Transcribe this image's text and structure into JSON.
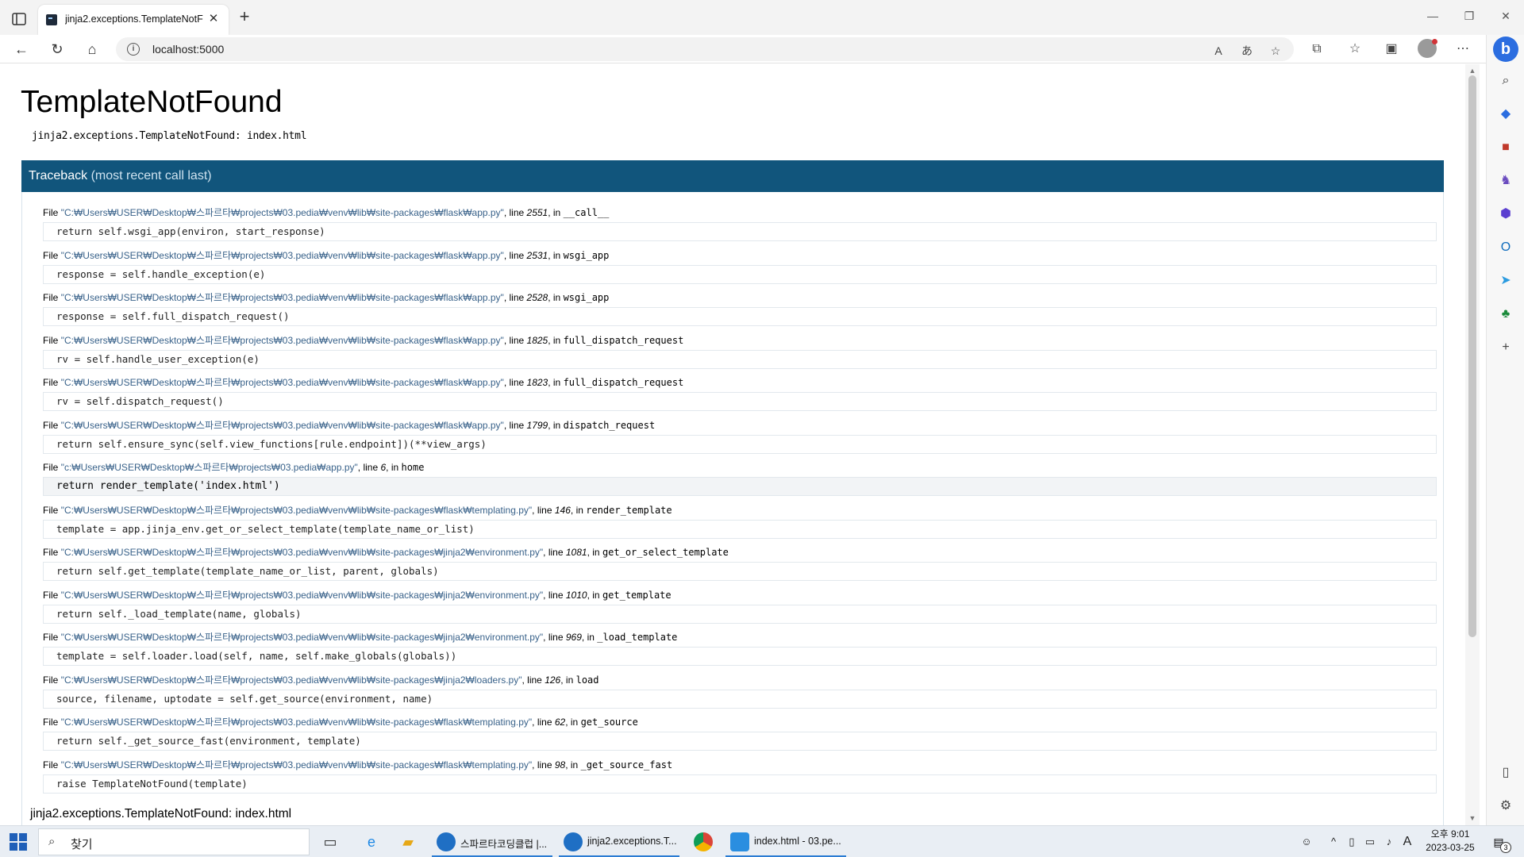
{
  "browser": {
    "tab_title": "jinja2.exceptions.TemplateNotF",
    "tab_close": "✕",
    "new_tab": "+",
    "url": "localhost:5000",
    "window_controls": [
      "—",
      "❐",
      "✕"
    ]
  },
  "error": {
    "title": "TemplateNotFound",
    "message": "jinja2.exceptions.TemplateNotFound: index.html",
    "traceback_title": "Traceback",
    "traceback_sub": "(most recent call last)",
    "footer": "jinja2.exceptions.TemplateNotFound: index.html"
  },
  "frames": [
    {
      "file": "\"C:₩Users₩USER₩Desktop₩스파르타₩projects₩03.pedia₩venv₩lib₩site-packages₩flask₩app.py\"",
      "line": "2551",
      "func": "__call__",
      "code": "return self.wsgi_app(environ, start_response)"
    },
    {
      "file": "\"C:₩Users₩USER₩Desktop₩스파르타₩projects₩03.pedia₩venv₩lib₩site-packages₩flask₩app.py\"",
      "line": "2531",
      "func": "wsgi_app",
      "code": "response = self.handle_exception(e)"
    },
    {
      "file": "\"C:₩Users₩USER₩Desktop₩스파르타₩projects₩03.pedia₩venv₩lib₩site-packages₩flask₩app.py\"",
      "line": "2528",
      "func": "wsgi_app",
      "code": "response = self.full_dispatch_request()"
    },
    {
      "file": "\"C:₩Users₩USER₩Desktop₩스파르타₩projects₩03.pedia₩venv₩lib₩site-packages₩flask₩app.py\"",
      "line": "1825",
      "func": "full_dispatch_request",
      "code": "rv = self.handle_user_exception(e)"
    },
    {
      "file": "\"C:₩Users₩USER₩Desktop₩스파르타₩projects₩03.pedia₩venv₩lib₩site-packages₩flask₩app.py\"",
      "line": "1823",
      "func": "full_dispatch_request",
      "code": "rv = self.dispatch_request()"
    },
    {
      "file": "\"C:₩Users₩USER₩Desktop₩스파르타₩projects₩03.pedia₩venv₩lib₩site-packages₩flask₩app.py\"",
      "line": "1799",
      "func": "dispatch_request",
      "code": "return self.ensure_sync(self.view_functions[rule.endpoint])(**view_args)"
    },
    {
      "file": "\"c:₩Users₩USER₩Desktop₩스파르타₩projects₩03.pedia₩app.py\"",
      "line": "6",
      "func": "home",
      "code": "return render_template('index.html')",
      "current": true
    },
    {
      "file": "\"C:₩Users₩USER₩Desktop₩스파르타₩projects₩03.pedia₩venv₩lib₩site-packages₩flask₩templating.py\"",
      "line": "146",
      "func": "render_template",
      "code": "template = app.jinja_env.get_or_select_template(template_name_or_list)"
    },
    {
      "file": "\"C:₩Users₩USER₩Desktop₩스파르타₩projects₩03.pedia₩venv₩lib₩site-packages₩jinja2₩environment.py\"",
      "line": "1081",
      "func": "get_or_select_template",
      "code": "return self.get_template(template_name_or_list, parent, globals)"
    },
    {
      "file": "\"C:₩Users₩USER₩Desktop₩스파르타₩projects₩03.pedia₩venv₩lib₩site-packages₩jinja2₩environment.py\"",
      "line": "1010",
      "func": "get_template",
      "code": "return self._load_template(name, globals)"
    },
    {
      "file": "\"C:₩Users₩USER₩Desktop₩스파르타₩projects₩03.pedia₩venv₩lib₩site-packages₩jinja2₩environment.py\"",
      "line": "969",
      "func": "_load_template",
      "code": "template = self.loader.load(self, name, self.make_globals(globals))"
    },
    {
      "file": "\"C:₩Users₩USER₩Desktop₩스파르타₩projects₩03.pedia₩venv₩lib₩site-packages₩jinja2₩loaders.py\"",
      "line": "126",
      "func": "load",
      "code": "source, filename, uptodate = self.get_source(environment, name)"
    },
    {
      "file": "\"C:₩Users₩USER₩Desktop₩스파르타₩projects₩03.pedia₩venv₩lib₩site-packages₩flask₩templating.py\"",
      "line": "62",
      "func": "get_source",
      "code": "return self._get_source_fast(environment, template)"
    },
    {
      "file": "\"C:₩Users₩USER₩Desktop₩스파르타₩projects₩03.pedia₩venv₩lib₩site-packages₩flask₩templating.py\"",
      "line": "98",
      "func": "_get_source_fast",
      "code": "raise TemplateNotFound(template)"
    }
  ],
  "labels": {
    "file": "File",
    "line": "line",
    "in": "in"
  },
  "taskbar": {
    "search_placeholder": "찾기",
    "apps": [
      {
        "label": "스파르타코딩클럽 |...",
        "color": "#1f6fc4",
        "icon": "edge-icon"
      },
      {
        "label": "jinja2.exceptions.T...",
        "color": "#1f6fc4",
        "icon": "edge-icon"
      },
      {
        "label": "",
        "color": "#db4437",
        "icon": "chrome-icon"
      },
      {
        "label": "index.html - 03.pe...",
        "color": "#2a8ee0",
        "icon": "vscode-icon"
      }
    ],
    "ime": "A",
    "clock_time": "오후 9:01",
    "clock_date": "2023-03-25",
    "notification_count": "3"
  },
  "colors": {
    "traceback_header": "#11557c",
    "file_link": "#39628a",
    "taskbar_accent": "#2b7cd3"
  }
}
